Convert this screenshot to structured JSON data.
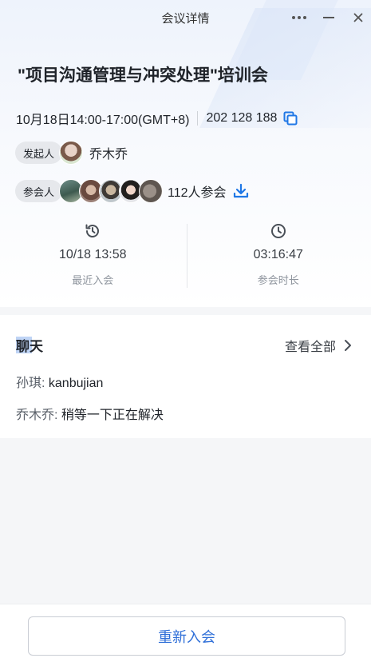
{
  "window": {
    "title": "会议详情"
  },
  "meeting": {
    "title": "\"项目沟通管理与冲突处理\"培训会",
    "time": "10月18日14:00-17:00(GMT+8)",
    "meeting_id": "202 128 188"
  },
  "host": {
    "tag": "发起人",
    "name": "乔木乔"
  },
  "attendees": {
    "tag": "参会人",
    "count_text": "112人参会"
  },
  "stats": [
    {
      "icon": "history-icon",
      "value": "10/18 13:58",
      "label": "最近入会"
    },
    {
      "icon": "clock-icon",
      "value": "03:16:47",
      "label": "参会时长"
    }
  ],
  "chat": {
    "title": "聊天",
    "view_all": "查看全部",
    "messages": [
      {
        "sender": "孙琪:",
        "text": " kanbujian"
      },
      {
        "sender": "乔木乔:",
        "text": " 稍等一下正在解决"
      }
    ]
  },
  "footer": {
    "rejoin_label": "重新入会"
  },
  "colors": {
    "accent": "#2f6fd8",
    "icon_blue": "#1f77e6"
  }
}
